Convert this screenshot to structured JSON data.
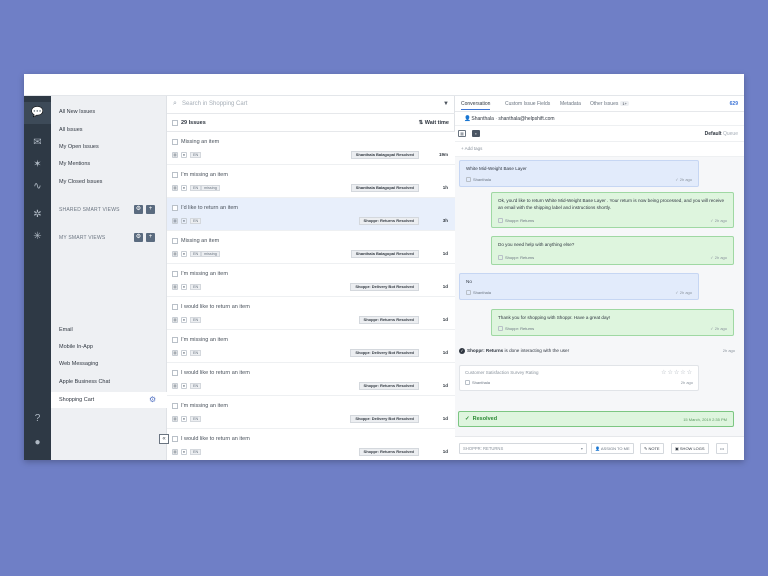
{
  "nav": {
    "items": [
      {
        "label": "All New Issues"
      },
      {
        "label": "All Issues"
      },
      {
        "label": "My Open Issues"
      },
      {
        "label": "My Mentions"
      },
      {
        "label": "My Closed Issues"
      }
    ],
    "shared_section": "SHARED SMART VIEWS",
    "my_section": "MY SMART VIEWS",
    "channels": [
      {
        "label": "Email"
      },
      {
        "label": "Mobile In-App"
      },
      {
        "label": "Web Messaging"
      },
      {
        "label": "Apple Business Chat"
      },
      {
        "label": "Shopping Cart"
      }
    ]
  },
  "list": {
    "search_placeholder": "Search in Shopping Cart",
    "count_label": "29 Issues",
    "sort_label": "Wait time",
    "rows": [
      {
        "title": "Missing an item",
        "tag": "",
        "assignee": "Shanthala Balagopal Resolved",
        "age": "19m"
      },
      {
        "title": "I'm missing an item",
        "tag": "missing",
        "assignee": "Shanthala Balagopal Resolved",
        "age": "1h"
      },
      {
        "title": "I'd like to return an item",
        "tag": "",
        "assignee": "Shoppr: Returns Resolved",
        "age": "3h"
      },
      {
        "title": "Missing an item",
        "tag": "missing",
        "assignee": "Shanthala Balagopal Resolved",
        "age": "1d"
      },
      {
        "title": "I'm missing an item",
        "tag": "",
        "assignee": "Shoppr: Delivery Bot Resolved",
        "age": "1d"
      },
      {
        "title": "I would like to return an item",
        "tag": "",
        "assignee": "Shoppr: Returns Resolved",
        "age": "1d"
      },
      {
        "title": "I'm missing an item",
        "tag": "",
        "assignee": "Shoppr: Delivery Bot Resolved",
        "age": "1d"
      },
      {
        "title": "I would like to return an item",
        "tag": "",
        "assignee": "Shoppr: Returns Resolved",
        "age": "1d"
      },
      {
        "title": "I'm missing an item",
        "tag": "",
        "assignee": "Shoppr: Delivery Bot Resolved",
        "age": "1d"
      },
      {
        "title": "I would like to return an item",
        "tag": "",
        "assignee": "Shoppr: Returns Resolved",
        "age": "1d"
      }
    ]
  },
  "convo": {
    "tabs": [
      {
        "label": "Conversation"
      },
      {
        "label": "Custom Issue Fields"
      },
      {
        "label": "Metadata"
      },
      {
        "label": "Other Issues"
      }
    ],
    "other_issues_count": "1+",
    "ticket_id": "629",
    "customer_name": "Shanthala",
    "customer_email": "shanthala@helpshift.com",
    "queue_bold": "Default",
    "queue_label": "Queue",
    "add_tags": "+ Add tags",
    "messages": [
      {
        "text": "White Mid-Weight Base Layer",
        "from": "Shanthala",
        "time": "2h ago"
      },
      {
        "text": "Ok, you'd like to return White Mid-Weight Base Layer . Your return is now being processed, and you will receive an email with the shipping label and instructions shortly.",
        "from": "Shoppr: Returns",
        "time": "2h ago"
      },
      {
        "text": "Do you need help with anything else?",
        "from": "Shoppr: Returns",
        "time": "2h ago"
      },
      {
        "text": "No",
        "from": "Shanthala",
        "time": "2h ago"
      },
      {
        "text": "Thank you for shopping with Shoppr. Have a great day!",
        "from": "Shoppr: Returns",
        "time": "2h ago"
      }
    ],
    "system_bold": "Shoppr: Returns",
    "system_text": "is done interacting with the user",
    "system_time": "2h ago",
    "survey_question": "Customer Satisfaction Survey Rating",
    "survey_stars": "☆☆☆☆☆",
    "survey_from": "Shanthala",
    "survey_time": "2h ago",
    "resolved_label": "Resolved",
    "resolved_time": "15 March, 2019 2:35 PM",
    "bottom": {
      "select_value": "SHOPPR: RETURNS",
      "assign": "ASSIGN TO ME",
      "note": "NOTE",
      "show_logs": "SHOW LOGS",
      "more": "•••"
    }
  },
  "colors": {
    "background": "#6f7fc6",
    "rail": "#2e3945",
    "accent": "#3b73d6",
    "resolved_green": "#2c8a35"
  }
}
